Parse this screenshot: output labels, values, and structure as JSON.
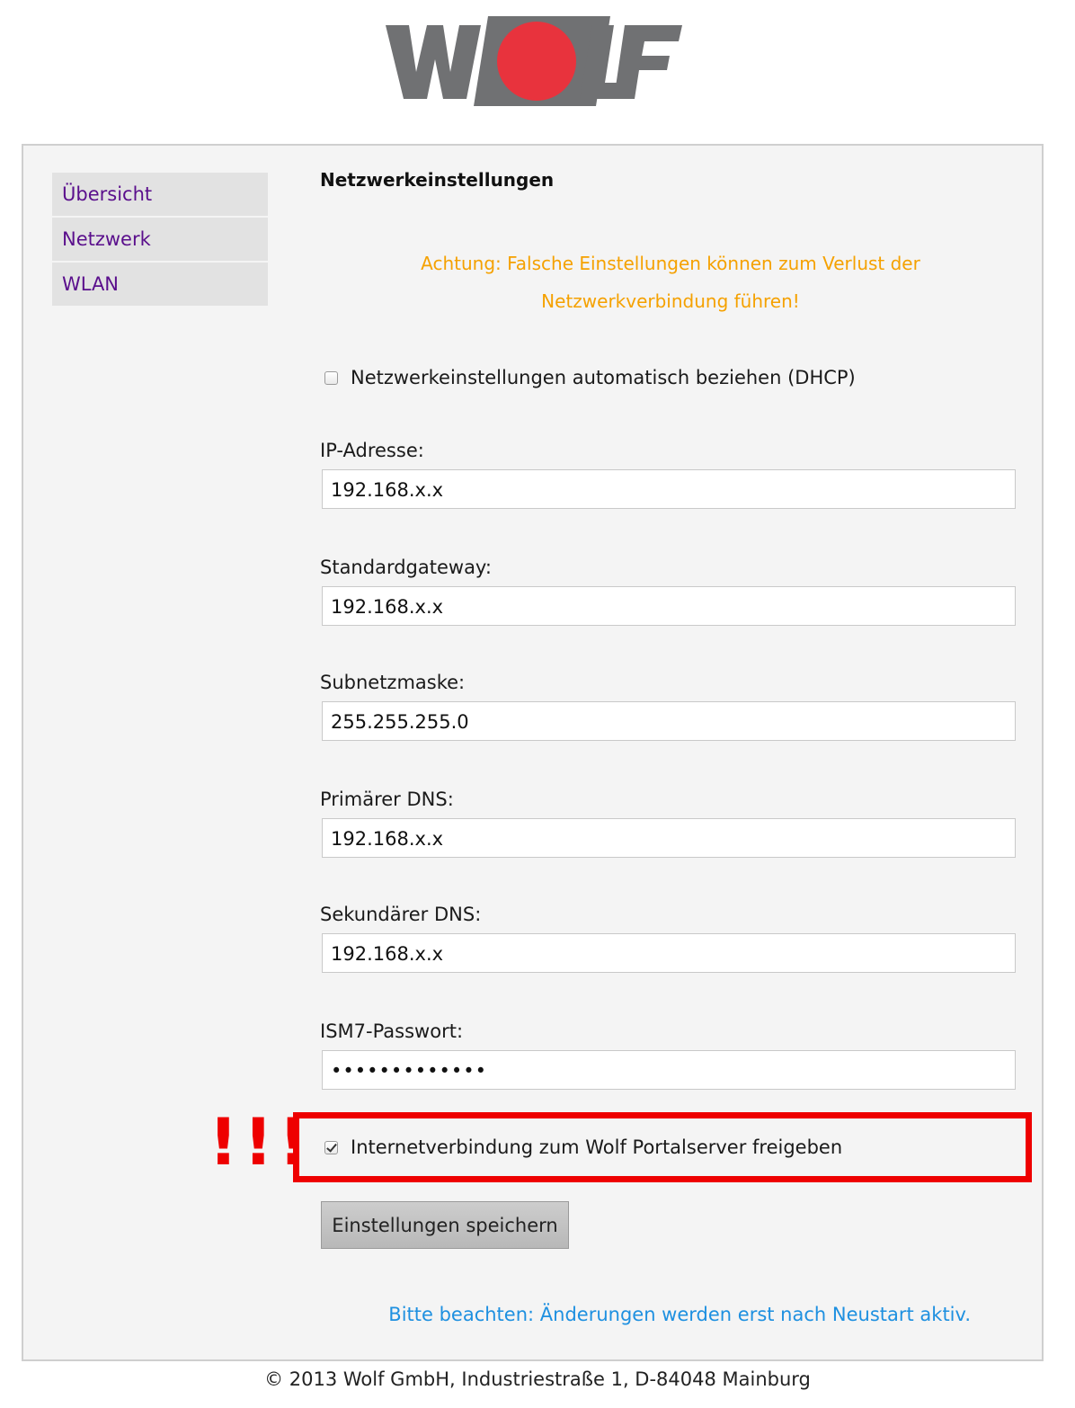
{
  "brand": {
    "logo_text": "WOLF",
    "logo_gray": "#707173",
    "logo_red": "#e8333d"
  },
  "nav": {
    "items": [
      {
        "label": "Übersicht"
      },
      {
        "label": "Netzwerk"
      },
      {
        "label": "WLAN"
      }
    ],
    "link_color": "#5a0f8c"
  },
  "main": {
    "heading": "Netzwerkeinstellungen",
    "warning_line1": "Achtung: Falsche Einstellungen können zum Verlust der",
    "warning_line2": "Netzwerkverbindung führen!",
    "dhcp": {
      "label": "Netzwerkeinstellungen automatisch beziehen (DHCP)",
      "checked": false
    },
    "fields": [
      {
        "label": "IP-Adresse:",
        "value": "192.168.x.x"
      },
      {
        "label": "Standardgateway:",
        "value": "192.168.x.x"
      },
      {
        "label": "Subnetzmaske:",
        "value": "255.255.255.0"
      },
      {
        "label": "Primärer DNS:",
        "value": "192.168.x.x"
      },
      {
        "label": "Sekundärer DNS:",
        "value": "192.168.x.x"
      },
      {
        "label": "ISM7-Passwort:",
        "value": "•••••••••••••"
      }
    ],
    "portal": {
      "label": "Internetverbindung zum Wolf Portalserver freigeben",
      "checked": true
    },
    "annotation": "!!!",
    "save_label": "Einstellungen speichern",
    "note": "Bitte beachten: Änderungen werden erst nach Neustart aktiv."
  },
  "footer": {
    "text": "© 2013 Wolf GmbH, Industriestraße 1, D-84048 Mainburg"
  },
  "colors": {
    "warning": "#f5a100",
    "note": "#1e90e0",
    "highlight": "#ee0000"
  }
}
